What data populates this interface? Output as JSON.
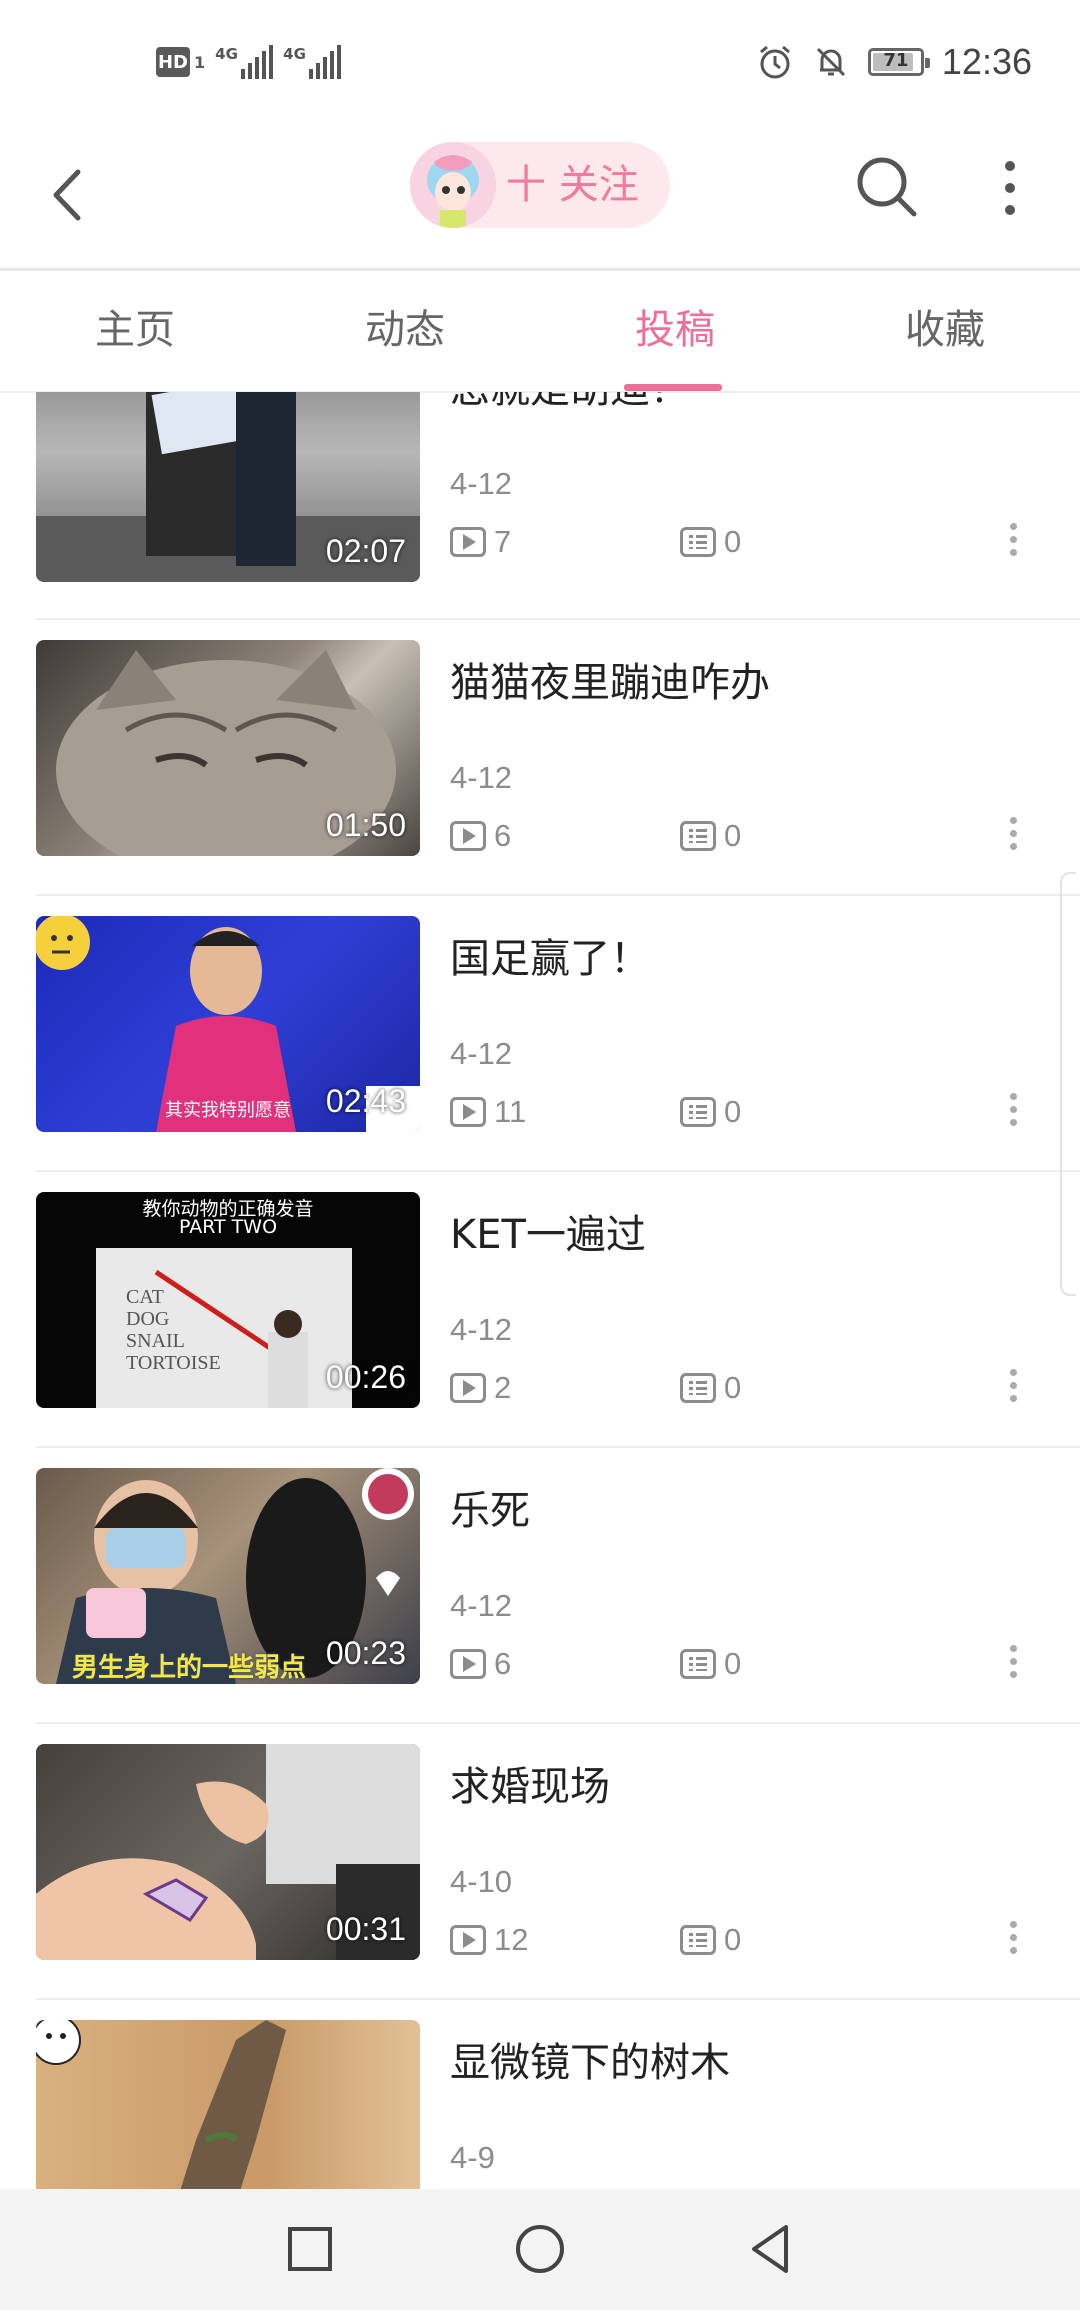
{
  "status_bar": {
    "hd_label": "HD",
    "hd_sub": "1",
    "network_1": "4G",
    "network_2": "4G",
    "battery_level": "71",
    "time": "12:36",
    "icons": [
      "alarm-icon",
      "bell-off-icon",
      "battery-icon"
    ]
  },
  "header": {
    "follow_label": "十 关注",
    "icons": [
      "back-arrow-icon",
      "search-icon",
      "more-vertical-icon"
    ]
  },
  "tabs": [
    {
      "label": "主页",
      "active": false
    },
    {
      "label": "动态",
      "active": false
    },
    {
      "label": "投稿",
      "active": true
    },
    {
      "label": "收藏",
      "active": false
    }
  ],
  "videos": [
    {
      "title": "您就是胡迪？",
      "date": "4-12",
      "plays": "7",
      "comments": "0",
      "duration": "02:07"
    },
    {
      "title": "猫猫夜里蹦迪咋办",
      "date": "4-12",
      "plays": "6",
      "comments": "0",
      "duration": "01:50"
    },
    {
      "title": "国足赢了！",
      "date": "4-12",
      "plays": "11",
      "comments": "0",
      "duration": "02:43",
      "thumb_caption": "其实我特别愿意"
    },
    {
      "title": "KET一遍过",
      "date": "4-12",
      "plays": "2",
      "comments": "0",
      "duration": "00:26",
      "thumb_caption": "教你动物的正确发音",
      "thumb_caption_2": "PART TWO",
      "board_words": [
        "CAT",
        "DOG",
        "SNAIL",
        "TORTOISE"
      ]
    },
    {
      "title": "乐死",
      "date": "4-12",
      "plays": "6",
      "comments": "0",
      "duration": "00:23",
      "thumb_caption": "男生身上的一些弱点"
    },
    {
      "title": "求婚现场",
      "date": "4-10",
      "plays": "12",
      "comments": "0",
      "duration": "00:31"
    },
    {
      "title": "显微镜下的树木",
      "date": "4-9",
      "plays": "",
      "comments": "",
      "duration": ""
    }
  ],
  "colors": {
    "accent": "#ee6f96",
    "follow_bg": "#fde8ee",
    "meta_text": "#8c8c8c",
    "nav_bg": "#f3f3f3"
  },
  "system_nav": [
    "recent-apps-square-icon",
    "home-circle-icon",
    "back-triangle-icon"
  ]
}
